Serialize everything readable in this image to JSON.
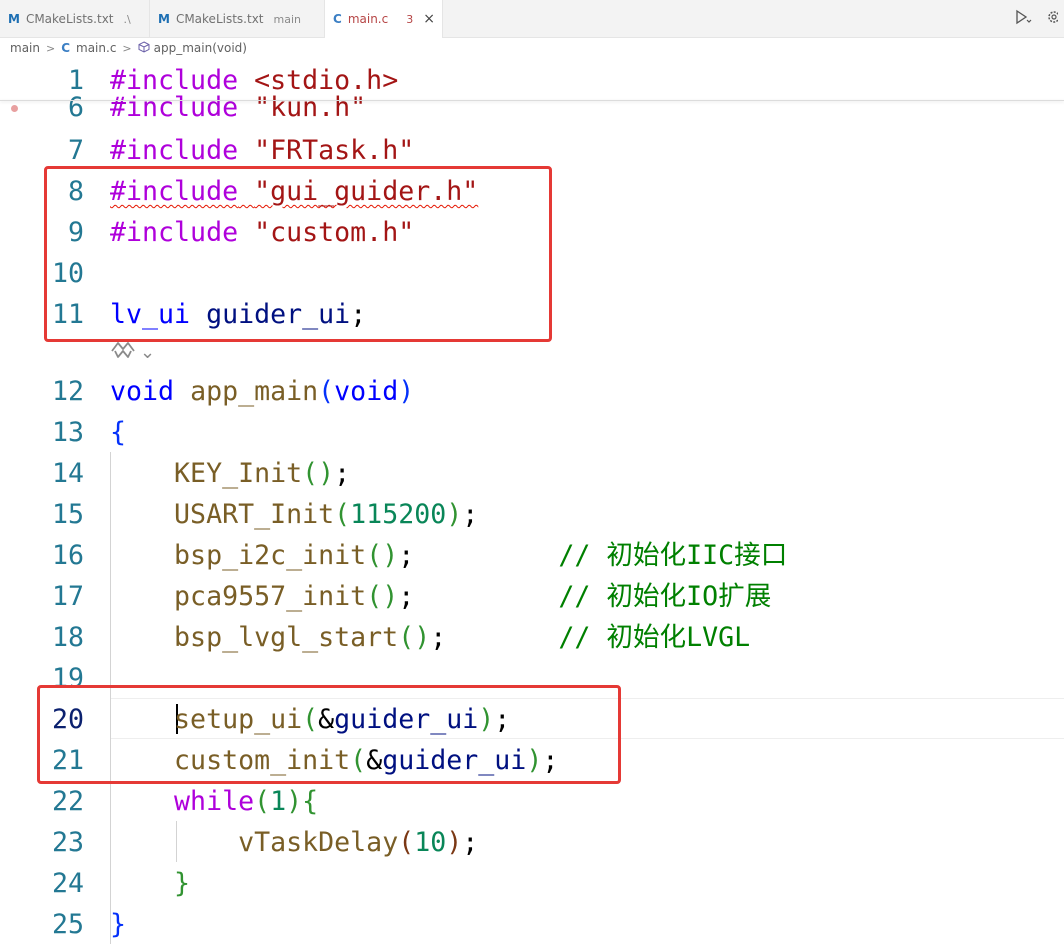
{
  "tabs": [
    {
      "icon": "M",
      "kind": "cmake",
      "name": "CMakeLists.txt",
      "detail": ".\\",
      "active": false
    },
    {
      "icon": "M",
      "kind": "cmake",
      "name": "CMakeLists.txt",
      "detail": "main",
      "active": false
    },
    {
      "icon": "C",
      "kind": "c",
      "name": "main.c",
      "problems": "3",
      "close": "×",
      "active": true
    }
  ],
  "breadcrumb": {
    "folder": "main",
    "file_icon": "C",
    "file": "main.c",
    "symbol": "app_main(void)"
  },
  "codelens": {
    "arrow": "⌄"
  },
  "lines": [
    {
      "num": "1",
      "tokens": [
        {
          "t": "#include",
          "c": "kw"
        },
        {
          "t": " "
        },
        {
          "t": "<stdio.h>",
          "c": "str"
        }
      ]
    },
    {
      "num": "6",
      "tokens": [
        {
          "t": "#include",
          "c": "kw"
        },
        {
          "t": " "
        },
        {
          "t": "\"kun.h\"",
          "c": "str"
        }
      ]
    },
    {
      "num": "7",
      "tokens": [
        {
          "t": "#include",
          "c": "kw"
        },
        {
          "t": " "
        },
        {
          "t": "\"FRTask.h\"",
          "c": "str"
        }
      ]
    },
    {
      "num": "8",
      "tokens": [
        {
          "t": "#include",
          "c": "kw",
          "sq": true
        },
        {
          "t": " ",
          "sq": true
        },
        {
          "t": "\"gui_guider.h\"",
          "c": "str",
          "sq": true
        }
      ]
    },
    {
      "num": "9",
      "tokens": [
        {
          "t": "#include",
          "c": "kw"
        },
        {
          "t": " "
        },
        {
          "t": "\"custom.h\"",
          "c": "str"
        }
      ]
    },
    {
      "num": "10",
      "tokens": []
    },
    {
      "num": "11",
      "tokens": [
        {
          "t": "lv_ui",
          "c": "type"
        },
        {
          "t": " "
        },
        {
          "t": "guider_ui",
          "c": "var"
        },
        {
          "t": ";"
        }
      ]
    },
    {
      "num": "12",
      "tokens": [
        {
          "t": "void",
          "c": "type"
        },
        {
          "t": " "
        },
        {
          "t": "app_main",
          "c": "fn"
        },
        {
          "t": "(",
          "c": "b1"
        },
        {
          "t": "void",
          "c": "type"
        },
        {
          "t": ")",
          "c": "b1"
        }
      ]
    },
    {
      "num": "13",
      "tokens": [
        {
          "t": "{",
          "c": "b1"
        }
      ]
    },
    {
      "num": "14",
      "tokens": [
        {
          "t": "    "
        },
        {
          "t": "KEY_Init",
          "c": "fn"
        },
        {
          "t": "()",
          "c": "b2"
        },
        {
          "t": ";"
        }
      ]
    },
    {
      "num": "15",
      "tokens": [
        {
          "t": "    "
        },
        {
          "t": "USART_Init",
          "c": "fn"
        },
        {
          "t": "(",
          "c": "b2"
        },
        {
          "t": "115200",
          "c": "num"
        },
        {
          "t": ")",
          "c": "b2"
        },
        {
          "t": ";"
        }
      ]
    },
    {
      "num": "16",
      "tokens": [
        {
          "t": "    "
        },
        {
          "t": "bsp_i2c_init",
          "c": "fn"
        },
        {
          "t": "()",
          "c": "b2"
        },
        {
          "t": ";         "
        },
        {
          "t": "// 初始化IIC接口",
          "c": "cmt"
        }
      ]
    },
    {
      "num": "17",
      "tokens": [
        {
          "t": "    "
        },
        {
          "t": "pca9557_init",
          "c": "fn"
        },
        {
          "t": "()",
          "c": "b2"
        },
        {
          "t": ";         "
        },
        {
          "t": "// 初始化IO扩展",
          "c": "cmt"
        }
      ]
    },
    {
      "num": "18",
      "tokens": [
        {
          "t": "    "
        },
        {
          "t": "bsp_lvgl_start",
          "c": "fn"
        },
        {
          "t": "()",
          "c": "b2"
        },
        {
          "t": ";       "
        },
        {
          "t": "// 初始化LVGL",
          "c": "cmt"
        }
      ]
    },
    {
      "num": "19",
      "tokens": []
    },
    {
      "num": "20",
      "current": true,
      "tokens": [
        {
          "t": "    "
        },
        {
          "t": "setup_ui",
          "c": "fn"
        },
        {
          "t": "(",
          "c": "b2"
        },
        {
          "t": "&"
        },
        {
          "t": "guider_ui",
          "c": "var"
        },
        {
          "t": ")",
          "c": "b2"
        },
        {
          "t": ";"
        }
      ]
    },
    {
      "num": "21",
      "tokens": [
        {
          "t": "    "
        },
        {
          "t": "custom_init",
          "c": "fn"
        },
        {
          "t": "(",
          "c": "b2"
        },
        {
          "t": "&"
        },
        {
          "t": "guider_ui",
          "c": "var"
        },
        {
          "t": ")",
          "c": "b2"
        },
        {
          "t": ";"
        }
      ]
    },
    {
      "num": "22",
      "tokens": [
        {
          "t": "    "
        },
        {
          "t": "while",
          "c": "kw"
        },
        {
          "t": "(",
          "c": "b2"
        },
        {
          "t": "1",
          "c": "num"
        },
        {
          "t": ")",
          "c": "b2"
        },
        {
          "t": "{",
          "c": "b2"
        }
      ]
    },
    {
      "num": "23",
      "tokens": [
        {
          "t": "        "
        },
        {
          "t": "vTaskDelay",
          "c": "fn"
        },
        {
          "t": "(",
          "c": "b3"
        },
        {
          "t": "10",
          "c": "num"
        },
        {
          "t": ")",
          "c": "b3"
        },
        {
          "t": ";"
        }
      ]
    },
    {
      "num": "24",
      "tokens": [
        {
          "t": "    "
        },
        {
          "t": "}",
          "c": "b2"
        }
      ]
    },
    {
      "num": "25",
      "tokens": [
        {
          "t": "}",
          "c": "b1"
        }
      ]
    }
  ]
}
